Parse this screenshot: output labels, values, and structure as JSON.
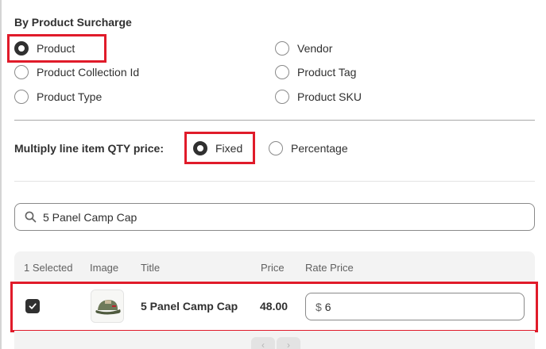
{
  "surcharge": {
    "title": "By Product Surcharge",
    "options": [
      {
        "label": "Product",
        "checked": true
      },
      {
        "label": "Product Collection Id",
        "checked": false
      },
      {
        "label": "Product Type",
        "checked": false
      },
      {
        "label": "Vendor",
        "checked": false
      },
      {
        "label": "Product Tag",
        "checked": false
      },
      {
        "label": "Product SKU",
        "checked": false
      }
    ]
  },
  "multiply": {
    "label": "Multiply line item QTY price:",
    "options": [
      {
        "label": "Fixed",
        "checked": true
      },
      {
        "label": "Percentage",
        "checked": false
      }
    ]
  },
  "search": {
    "value": "5 Panel Camp Cap",
    "icon": "search-icon"
  },
  "table": {
    "headers": {
      "selected": "1 Selected",
      "image": "Image",
      "title": "Title",
      "price": "Price",
      "rate_price": "Rate Price"
    },
    "rows": [
      {
        "checked": true,
        "title": "5 Panel Camp Cap",
        "price": "48.00",
        "rate_prefix": "$",
        "rate_value": "6"
      }
    ]
  },
  "pagination": {
    "prev": "‹",
    "next": "›"
  },
  "colors": {
    "highlight": "#e01b2a",
    "text": "#303030",
    "header_bg": "#f3f3f3"
  }
}
